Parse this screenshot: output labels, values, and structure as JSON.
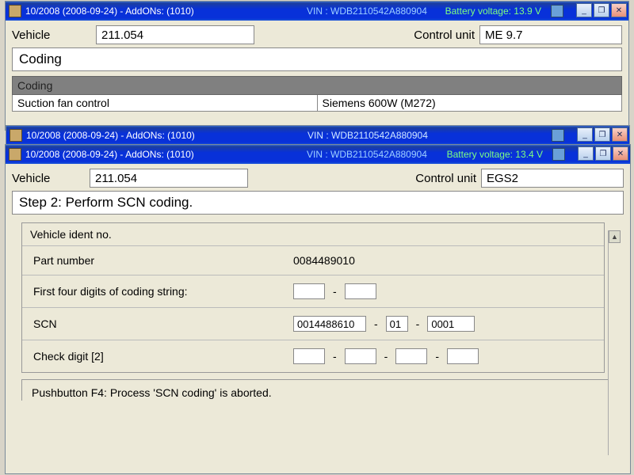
{
  "win1": {
    "title": "10/2008 (2008-09-24) - AddONs: (1010)",
    "vin_label": "VIN : WDB2110542A880904",
    "battery": "Battery voltage: 13.9 V",
    "vehicle_label": "Vehicle",
    "vehicle_value": "211.054",
    "cu_label": "Control unit",
    "cu_value": "ME 9.7",
    "section": "Coding",
    "grey_header": "Coding",
    "row1_left": "Suction fan control",
    "row1_right": "Siemens 600W (M272)"
  },
  "win2": {
    "title": "10/2008 (2008-09-24) - AddONs: (1010)",
    "vin_label": "VIN : WDB2110542A880904"
  },
  "win3": {
    "title": "10/2008 (2008-09-24) - AddONs: (1010)",
    "vin_label": "VIN : WDB2110542A880904",
    "battery": "Battery voltage: 13.4 V",
    "vehicle_label": "Vehicle",
    "vehicle_value": "211.054",
    "cu_label": "Control unit",
    "cu_value": "EGS2",
    "step_title": "Step 2: Perform SCN coding.",
    "ident_label": "Vehicle ident no.",
    "partnum_label": "Part number",
    "partnum_value": "0084489010",
    "first4_label": "First four digits of coding string:",
    "first4_a": "",
    "first4_b": "",
    "scn_label": "SCN",
    "scn_a": "0014488610",
    "scn_b": "01",
    "scn_c": "0001",
    "check_label": "Check digit [2]",
    "check_a": "",
    "check_b": "",
    "check_c": "",
    "check_d": "",
    "footer": "Pushbutton F4: Process 'SCN coding' is aborted."
  },
  "glyph": {
    "min": "_",
    "restore": "❐",
    "close": "✕",
    "up": "▲",
    "down": "▼"
  }
}
